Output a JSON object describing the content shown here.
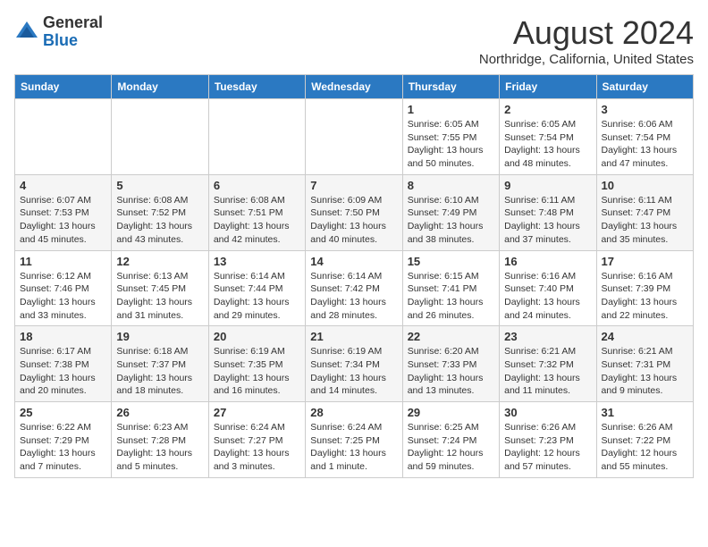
{
  "header": {
    "logo_general": "General",
    "logo_blue": "Blue",
    "month": "August 2024",
    "location": "Northridge, California, United States"
  },
  "calendar": {
    "days_of_week": [
      "Sunday",
      "Monday",
      "Tuesday",
      "Wednesday",
      "Thursday",
      "Friday",
      "Saturday"
    ],
    "weeks": [
      [
        {
          "day": "",
          "info": ""
        },
        {
          "day": "",
          "info": ""
        },
        {
          "day": "",
          "info": ""
        },
        {
          "day": "",
          "info": ""
        },
        {
          "day": "1",
          "info": "Sunrise: 6:05 AM\nSunset: 7:55 PM\nDaylight: 13 hours\nand 50 minutes."
        },
        {
          "day": "2",
          "info": "Sunrise: 6:05 AM\nSunset: 7:54 PM\nDaylight: 13 hours\nand 48 minutes."
        },
        {
          "day": "3",
          "info": "Sunrise: 6:06 AM\nSunset: 7:54 PM\nDaylight: 13 hours\nand 47 minutes."
        }
      ],
      [
        {
          "day": "4",
          "info": "Sunrise: 6:07 AM\nSunset: 7:53 PM\nDaylight: 13 hours\nand 45 minutes."
        },
        {
          "day": "5",
          "info": "Sunrise: 6:08 AM\nSunset: 7:52 PM\nDaylight: 13 hours\nand 43 minutes."
        },
        {
          "day": "6",
          "info": "Sunrise: 6:08 AM\nSunset: 7:51 PM\nDaylight: 13 hours\nand 42 minutes."
        },
        {
          "day": "7",
          "info": "Sunrise: 6:09 AM\nSunset: 7:50 PM\nDaylight: 13 hours\nand 40 minutes."
        },
        {
          "day": "8",
          "info": "Sunrise: 6:10 AM\nSunset: 7:49 PM\nDaylight: 13 hours\nand 38 minutes."
        },
        {
          "day": "9",
          "info": "Sunrise: 6:11 AM\nSunset: 7:48 PM\nDaylight: 13 hours\nand 37 minutes."
        },
        {
          "day": "10",
          "info": "Sunrise: 6:11 AM\nSunset: 7:47 PM\nDaylight: 13 hours\nand 35 minutes."
        }
      ],
      [
        {
          "day": "11",
          "info": "Sunrise: 6:12 AM\nSunset: 7:46 PM\nDaylight: 13 hours\nand 33 minutes."
        },
        {
          "day": "12",
          "info": "Sunrise: 6:13 AM\nSunset: 7:45 PM\nDaylight: 13 hours\nand 31 minutes."
        },
        {
          "day": "13",
          "info": "Sunrise: 6:14 AM\nSunset: 7:44 PM\nDaylight: 13 hours\nand 29 minutes."
        },
        {
          "day": "14",
          "info": "Sunrise: 6:14 AM\nSunset: 7:42 PM\nDaylight: 13 hours\nand 28 minutes."
        },
        {
          "day": "15",
          "info": "Sunrise: 6:15 AM\nSunset: 7:41 PM\nDaylight: 13 hours\nand 26 minutes."
        },
        {
          "day": "16",
          "info": "Sunrise: 6:16 AM\nSunset: 7:40 PM\nDaylight: 13 hours\nand 24 minutes."
        },
        {
          "day": "17",
          "info": "Sunrise: 6:16 AM\nSunset: 7:39 PM\nDaylight: 13 hours\nand 22 minutes."
        }
      ],
      [
        {
          "day": "18",
          "info": "Sunrise: 6:17 AM\nSunset: 7:38 PM\nDaylight: 13 hours\nand 20 minutes."
        },
        {
          "day": "19",
          "info": "Sunrise: 6:18 AM\nSunset: 7:37 PM\nDaylight: 13 hours\nand 18 minutes."
        },
        {
          "day": "20",
          "info": "Sunrise: 6:19 AM\nSunset: 7:35 PM\nDaylight: 13 hours\nand 16 minutes."
        },
        {
          "day": "21",
          "info": "Sunrise: 6:19 AM\nSunset: 7:34 PM\nDaylight: 13 hours\nand 14 minutes."
        },
        {
          "day": "22",
          "info": "Sunrise: 6:20 AM\nSunset: 7:33 PM\nDaylight: 13 hours\nand 13 minutes."
        },
        {
          "day": "23",
          "info": "Sunrise: 6:21 AM\nSunset: 7:32 PM\nDaylight: 13 hours\nand 11 minutes."
        },
        {
          "day": "24",
          "info": "Sunrise: 6:21 AM\nSunset: 7:31 PM\nDaylight: 13 hours\nand 9 minutes."
        }
      ],
      [
        {
          "day": "25",
          "info": "Sunrise: 6:22 AM\nSunset: 7:29 PM\nDaylight: 13 hours\nand 7 minutes."
        },
        {
          "day": "26",
          "info": "Sunrise: 6:23 AM\nSunset: 7:28 PM\nDaylight: 13 hours\nand 5 minutes."
        },
        {
          "day": "27",
          "info": "Sunrise: 6:24 AM\nSunset: 7:27 PM\nDaylight: 13 hours\nand 3 minutes."
        },
        {
          "day": "28",
          "info": "Sunrise: 6:24 AM\nSunset: 7:25 PM\nDaylight: 13 hours\nand 1 minute."
        },
        {
          "day": "29",
          "info": "Sunrise: 6:25 AM\nSunset: 7:24 PM\nDaylight: 12 hours\nand 59 minutes."
        },
        {
          "day": "30",
          "info": "Sunrise: 6:26 AM\nSunset: 7:23 PM\nDaylight: 12 hours\nand 57 minutes."
        },
        {
          "day": "31",
          "info": "Sunrise: 6:26 AM\nSunset: 7:22 PM\nDaylight: 12 hours\nand 55 minutes."
        }
      ]
    ]
  }
}
